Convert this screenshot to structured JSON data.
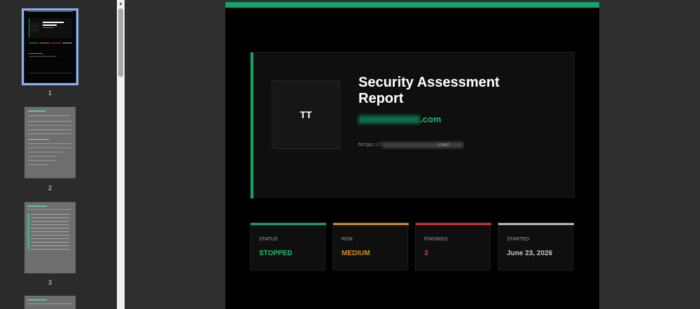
{
  "sidebar": {
    "pages": [
      {
        "number": "1",
        "selected": true
      },
      {
        "number": "2",
        "selected": false
      },
      {
        "number": "3",
        "selected": false
      }
    ]
  },
  "report": {
    "avatar_text": "TT",
    "title": "Security Assessment Report",
    "domain": ".com",
    "url": "https://",
    "url_mid": ".com/",
    "accent_color": "#12a36b"
  },
  "cards": [
    {
      "label": "STATUS",
      "value": "STOPPED",
      "color": "#1bbf7f",
      "bar": "#12a36b"
    },
    {
      "label": "RISK",
      "value": "MEDIUM",
      "color": "#d48e1a",
      "bar": "#c98a13"
    },
    {
      "label": "FINDINGS",
      "value": "3",
      "color": "#e03c3c",
      "bar": "#d12f2f"
    },
    {
      "label": "STARTED",
      "value": "June 23, 2026",
      "color": "#c8c8c8",
      "bar": "#b5b5b5"
    }
  ]
}
